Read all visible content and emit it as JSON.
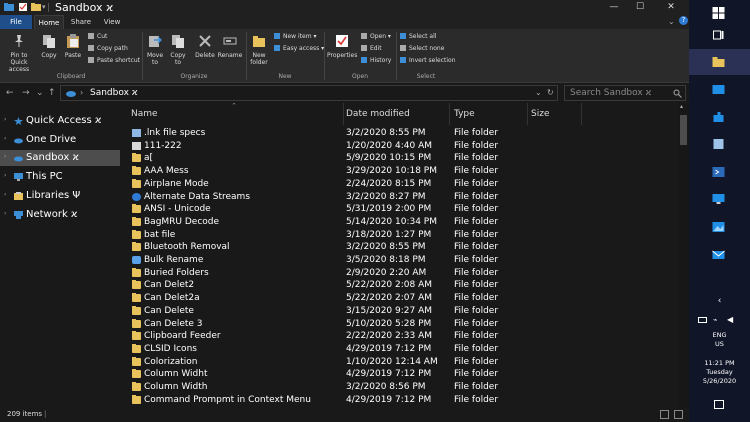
{
  "window": {
    "title": "Sandbox ϰ",
    "controls": {
      "minimize": "—",
      "maximize": "☐",
      "close": "✕"
    }
  },
  "tabs": [
    {
      "label": "File"
    },
    {
      "label": "Home"
    },
    {
      "label": "Share"
    },
    {
      "label": "View"
    }
  ],
  "ribbon": {
    "pin": "Pin to Quick access",
    "copy": "Copy",
    "paste": "Paste",
    "cut": "Cut",
    "copy_path": "Copy path",
    "paste_shortcut": "Paste shortcut",
    "move_to": "Move to",
    "copy_to": "Copy to",
    "delete": "Delete",
    "rename": "Rename",
    "new_folder": "New folder",
    "new_item": "New item ▾",
    "easy_access": "Easy access ▾",
    "properties": "Properties",
    "open": "Open ▾",
    "edit": "Edit",
    "history": "History",
    "select_all": "Select all",
    "select_none": "Select none",
    "invert_selection": "Invert selection",
    "groups": {
      "clipboard": "Clipboard",
      "organize": "Organize",
      "new": "New",
      "open": "Open",
      "select": "Select"
    }
  },
  "nav": {
    "back": "←",
    "forward": "→",
    "recent": "⌄",
    "up": "↑",
    "address": "Sandbox ϰ",
    "address_sep": "›",
    "search_placeholder": "Search Sandbox ϰ"
  },
  "sidebar": {
    "items": [
      {
        "label": "Quick Access ϰ"
      },
      {
        "label": "One Drive"
      },
      {
        "label": "Sandbox ϰ"
      },
      {
        "label": "This PC"
      },
      {
        "label": "Libraries Ψ"
      },
      {
        "label": "Network ϰ"
      }
    ]
  },
  "columns": {
    "name": "Name",
    "date": "Date modified",
    "type": "Type",
    "size": "Size"
  },
  "files": [
    {
      "name": ".lnk file specs",
      "date": "3/2/2020 8:55 PM",
      "type": "File folder",
      "icon": "special-folder-icon"
    },
    {
      "name": "111-222",
      "date": "1/20/2020 4:40 AM",
      "type": "File folder",
      "icon": "printer-folder-icon"
    },
    {
      "name": "a[",
      "date": "5/9/2020 10:15 PM",
      "type": "File folder",
      "icon": "folder-icon"
    },
    {
      "name": "AAA Mess",
      "date": "3/29/2020 10:18 PM",
      "type": "File folder",
      "icon": "folder-icon"
    },
    {
      "name": "Airplane Mode",
      "date": "2/24/2020 8:15 PM",
      "type": "File folder",
      "icon": "folder-icon"
    },
    {
      "name": "Alternate Data Streams",
      "date": "3/2/2020 8:27 PM",
      "type": "File folder",
      "icon": "help-folder-icon"
    },
    {
      "name": "ANSI - Unicode",
      "date": "5/31/2019 2:00 PM",
      "type": "File folder",
      "icon": "folder-icon"
    },
    {
      "name": "BagMRU Decode",
      "date": "5/14/2020 10:34 PM",
      "type": "File folder",
      "icon": "folder-icon"
    },
    {
      "name": "bat file",
      "date": "3/18/2020 1:27 PM",
      "type": "File folder",
      "icon": "folder-icon"
    },
    {
      "name": "Bluetooth Removal",
      "date": "3/2/2020 8:55 PM",
      "type": "File folder",
      "icon": "folder-icon"
    },
    {
      "name": "Bulk Rename",
      "date": "3/5/2020 8:18 PM",
      "type": "File folder",
      "icon": "shell-folder-icon"
    },
    {
      "name": "Buried  Folders",
      "date": "2/9/2020 2:20 AM",
      "type": "File folder",
      "icon": "folder-icon"
    },
    {
      "name": "Can Delet2",
      "date": "5/22/2020 2:08 AM",
      "type": "File folder",
      "icon": "folder-icon"
    },
    {
      "name": "Can Delet2a",
      "date": "5/22/2020 2:07 AM",
      "type": "File folder",
      "icon": "folder-icon"
    },
    {
      "name": "Can Delete",
      "date": "3/15/2020 9:27 AM",
      "type": "File folder",
      "icon": "folder-icon"
    },
    {
      "name": "Can Delete 3",
      "date": "5/10/2020 5:28 PM",
      "type": "File folder",
      "icon": "folder-icon"
    },
    {
      "name": "Clipboard Feeder",
      "date": "2/22/2020 2:33 AM",
      "type": "File folder",
      "icon": "folder-icon"
    },
    {
      "name": "CLSID Icons",
      "date": "4/29/2019 7:12 PM",
      "type": "File folder",
      "icon": "folder-icon"
    },
    {
      "name": "Colorization",
      "date": "1/10/2020 12:14 AM",
      "type": "File folder",
      "icon": "folder-icon"
    },
    {
      "name": "Column Widht",
      "date": "4/29/2019 7:12 PM",
      "type": "File folder",
      "icon": "folder-icon"
    },
    {
      "name": "Column Width",
      "date": "3/2/2020 8:56 PM",
      "type": "File folder",
      "icon": "folder-icon"
    },
    {
      "name": "Command Prompmt in Context Menu",
      "date": "4/29/2019 7:12 PM",
      "type": "File folder",
      "icon": "folder-icon"
    }
  ],
  "status": {
    "items": "209 items",
    "sep": "|"
  },
  "taskbar": {
    "tray_chevron": "‹",
    "lang_1": "ENG",
    "lang_2": "US",
    "time": "11:21 PM",
    "day": "Tuesday",
    "date": "5/26/2020"
  },
  "colors": {
    "accent": "#1f4e8a",
    "folder": "#e8c25a",
    "taskbar": "#101528",
    "background": "#191919"
  }
}
